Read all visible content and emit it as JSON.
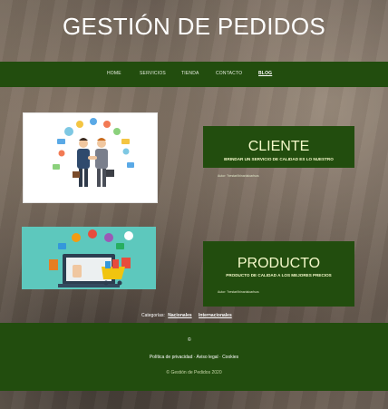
{
  "header": {
    "title": "GESTIÓN DE PEDIDOS"
  },
  "nav": {
    "items": [
      {
        "label": "HOME"
      },
      {
        "label": "SERVICIOS"
      },
      {
        "label": "TIENDA"
      },
      {
        "label": "CONTACTO"
      },
      {
        "label": "BLOG",
        "active": true
      }
    ]
  },
  "posts": [
    {
      "title": "CLIENTE",
      "subtitle": "BRINDAR UN SERVICIO DE CALIDAD ES LO NUESTRO",
      "author": "Autor: \"bestarl/binarialoarlsos",
      "image": "business-handshake-illustration"
    },
    {
      "title": "PRODUCTO",
      "subtitle": "PRODUCTO DE CALIDAD A LOS MEJORES PRECIOS",
      "author": "Autor: \"bestarl/binarialoarlsos",
      "image": "online-shopping-cart-illustration"
    }
  ],
  "categories": {
    "label": "Categorías:",
    "items": [
      "Nacionales",
      "Internacionales"
    ]
  },
  "footer": {
    "symbol": "©",
    "links": "Política de privacidad · Aviso legal · Cookies",
    "copyright": "© Gestión de Pedidos 2020"
  },
  "colors": {
    "brand_green": "#224d0e",
    "card_text": "#f4f9c9",
    "image2_bg": "#5dc8bd"
  }
}
